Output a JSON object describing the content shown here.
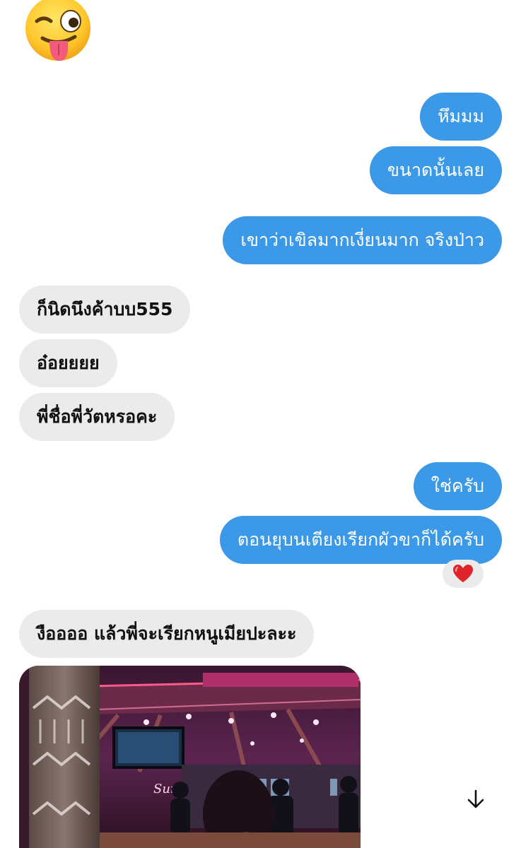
{
  "header_emoji": "winking-face-with-tongue",
  "messages": [
    {
      "dir": "out",
      "text": "หึมมม"
    },
    {
      "dir": "out",
      "text": "ขนาดนั้นเลย"
    },
    {
      "dir": "out",
      "text": "เขาว่าเขิลมากเงี่ยนมาก จริงป่าว"
    },
    {
      "dir": "in",
      "text": "ก็นิดนึงค้าบบ555"
    },
    {
      "dir": "in",
      "text": "อ๋อยยยย"
    },
    {
      "dir": "in",
      "text": "พี่ชื่อพี่วัตหรอคะ"
    },
    {
      "dir": "out",
      "text": "ใช่ครับ"
    },
    {
      "dir": "out",
      "text": "ตอนยุบนเตียงเรียกผัวขาก็ได้ครับ",
      "reaction": "❤️"
    },
    {
      "dir": "in",
      "text": "งืออออ แล้วพี่จะเรียกหนูเมียปะละะ"
    },
    {
      "dir": "in",
      "type": "photo",
      "photo_neon_text": "Surf"
    }
  ],
  "colors": {
    "outgoing_bubble": "#3b99e7",
    "incoming_bubble": "#ebebeb",
    "reaction_heart": "#e0242b"
  },
  "controls": {
    "scroll_down_icon": "arrow-down-icon"
  }
}
